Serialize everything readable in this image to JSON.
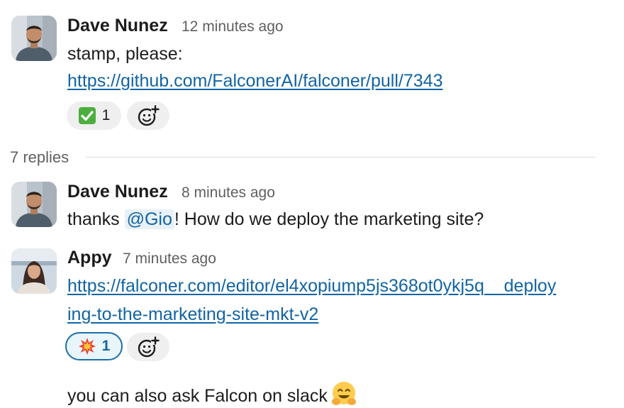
{
  "messages": [
    {
      "author": "Dave Nunez",
      "time": "12 minutes ago",
      "text": "stamp, please:",
      "link": "https://github.com/FalconerAI/falconer/pull/7343",
      "reactions": [
        {
          "emoji": "white-check-mark",
          "count": "1"
        }
      ]
    },
    {
      "author": "Dave Nunez",
      "time": "8 minutes ago",
      "text_before": "thanks ",
      "mention": "@Gio",
      "text_after": "! How do we deploy the marketing site?"
    },
    {
      "author": "Appy",
      "time": "7 minutes ago",
      "link_line1": "https://falconer.com/editor/el4xopiump5js368ot0ykj5q__deploy",
      "link_line2": "ing-to-the-marketing-site-mkt-v2",
      "reactions": [
        {
          "emoji": "collision",
          "count": "1"
        }
      ],
      "followup": "you can also ask Falcon on slack"
    }
  ],
  "thread": {
    "replies_label": "7 replies"
  },
  "icons": {
    "add_reaction": "add-reaction-icon",
    "hugging_face": "hugging-face-icon"
  },
  "colors": {
    "link": "#1264a3",
    "mention_bg": "#e8f1f8",
    "active_reaction_border": "#1d6fa8"
  }
}
